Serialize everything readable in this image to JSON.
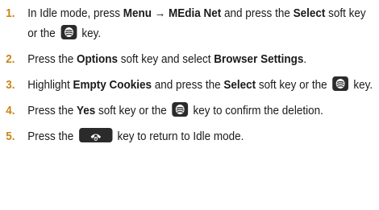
{
  "colors": {
    "number": "#c8861a",
    "text": "#1a1a1a",
    "key_bg": "#2b2b2b"
  },
  "steps": [
    {
      "num": "1.",
      "parts": [
        "In Idle mode, press ",
        "Menu → MEdia Net",
        " and press the ",
        "Select",
        " soft key or the ",
        " key."
      ]
    },
    {
      "num": "2.",
      "parts": [
        "Press the ",
        "Options",
        " soft key and select ",
        "Browser Settings",
        "."
      ]
    },
    {
      "num": "3.",
      "parts": [
        "Highlight ",
        "Empty Cookies",
        " and press the ",
        "Select",
        " soft key or the ",
        " key."
      ]
    },
    {
      "num": "4.",
      "parts": [
        "Press the ",
        "Yes",
        " soft key or the ",
        " key to confirm the deletion."
      ]
    },
    {
      "num": "5.",
      "parts": [
        "Press the ",
        " key to return to Idle mode."
      ]
    }
  ],
  "icons": {
    "select_key": "select-key-icon",
    "end_key": "end-key-icon"
  }
}
